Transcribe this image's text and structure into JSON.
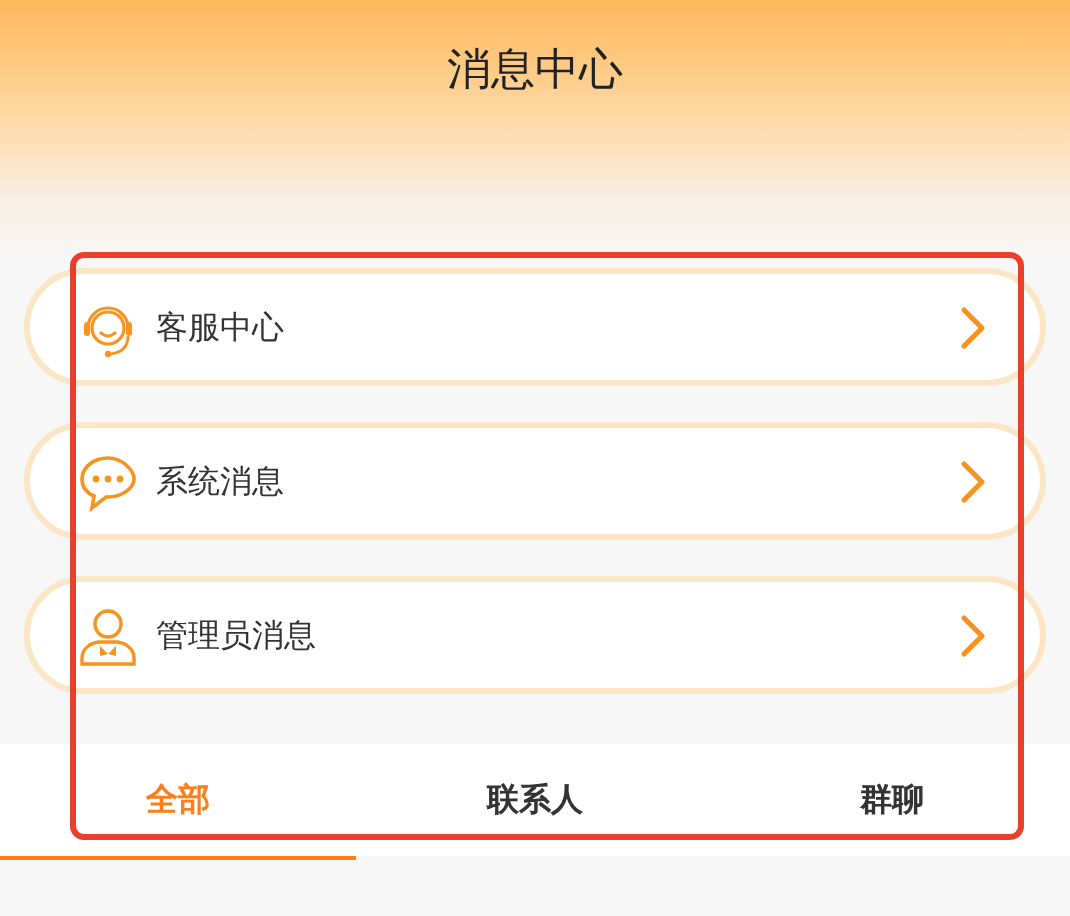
{
  "header": {
    "title": "消息中心"
  },
  "items": [
    {
      "kind": "service",
      "label": "客服中心"
    },
    {
      "kind": "chat",
      "label": "系统消息"
    },
    {
      "kind": "admin",
      "label": "管理员消息"
    }
  ],
  "tabs": [
    {
      "label": "全部",
      "selected": true
    },
    {
      "label": "联系人",
      "selected": false
    },
    {
      "label": "群聊",
      "selected": false
    }
  ],
  "highlight": {
    "shown": true
  }
}
